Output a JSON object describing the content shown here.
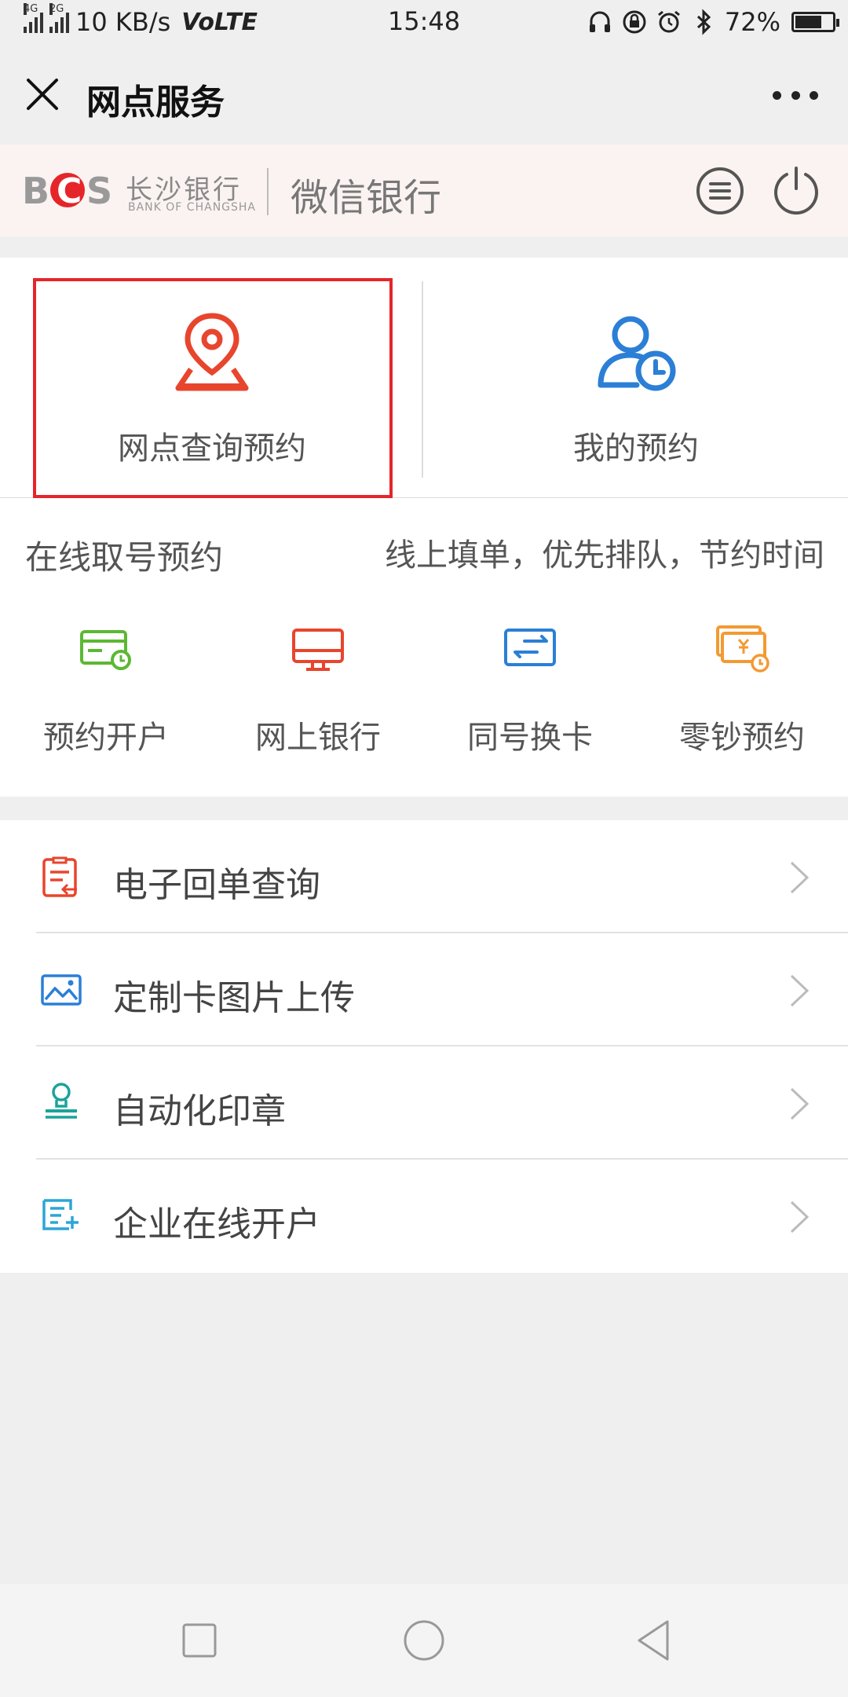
{
  "status_bar": {
    "net_4g": "4G",
    "net_2g": "2G",
    "speed": "10 KB/s",
    "volte": "VoLTE",
    "time": "15:48",
    "battery_text": "72%",
    "battery_level": 0.72
  },
  "title_bar": {
    "title": "网点服务"
  },
  "bank_header": {
    "logo_text": "BCS",
    "bank_name_cn": "长沙银行",
    "bank_name_en": "BANK OF CHANGSHA",
    "channel": "微信银行"
  },
  "top_cards": [
    {
      "label": "网点查询预约",
      "icon": "location-pin-icon",
      "color": "#e8452d"
    },
    {
      "label": "我的预约",
      "icon": "user-clock-icon",
      "color": "#2b7fd6"
    }
  ],
  "queue": {
    "title": "在线取号预约",
    "subtitle": "线上填单，优先排队，节约时间",
    "services": [
      {
        "label": "预约开户",
        "icon": "card-clock-icon",
        "color": "#5cb833"
      },
      {
        "label": "网上银行",
        "icon": "monitor-icon",
        "color": "#e8452d"
      },
      {
        "label": "同号换卡",
        "icon": "card-swap-icon",
        "color": "#2b7fd6"
      },
      {
        "label": "零钞预约",
        "icon": "cash-clock-icon",
        "color": "#f39a33"
      }
    ]
  },
  "list": [
    {
      "label": "电子回单查询",
      "icon": "receipt-icon",
      "color": "#e8452d"
    },
    {
      "label": "定制卡图片上传",
      "icon": "image-icon",
      "color": "#2b7fd6"
    },
    {
      "label": "自动化印章",
      "icon": "stamp-icon",
      "color": "#1aa39a"
    },
    {
      "label": "企业在线开户",
      "icon": "enterprise-doc-icon",
      "color": "#2ba6d6"
    }
  ]
}
